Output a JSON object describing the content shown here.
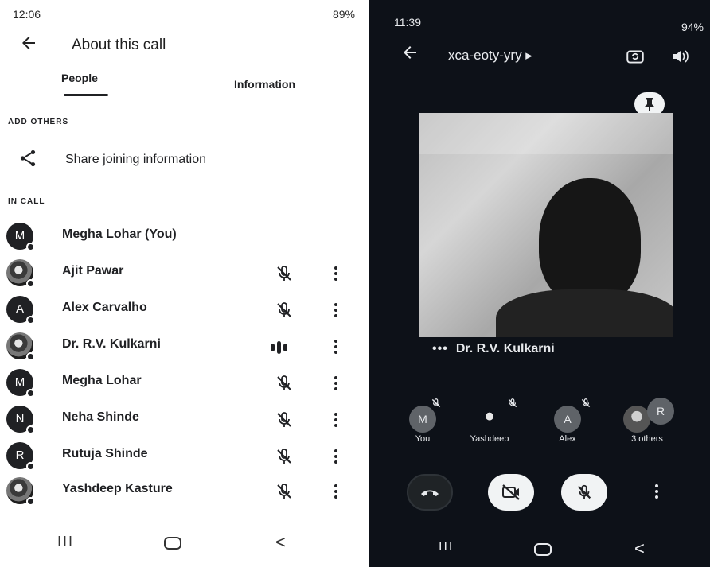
{
  "left_phone": {
    "status_bar": {
      "time": "12:06",
      "battery": "89%"
    },
    "app_bar": {
      "title": "About this call"
    },
    "tabs": [
      {
        "label": "People",
        "selected": true
      },
      {
        "label": "Information",
        "selected": false
      }
    ],
    "add_others": {
      "header": "ADD OTHERS",
      "share_label": "Share joining information"
    },
    "in_call": {
      "header": "IN CALL",
      "participants": [
        {
          "name": "Megha Lohar (You)",
          "initial": "M",
          "avatar": "letter",
          "mic": "none"
        },
        {
          "name": "Ajit Pawar",
          "initial": "",
          "avatar": "photo",
          "mic": "muted"
        },
        {
          "name": "Alex Carvalho",
          "initial": "A",
          "avatar": "letter",
          "mic": "muted"
        },
        {
          "name": "Dr. R.V. Kulkarni",
          "initial": "",
          "avatar": "photo",
          "mic": "speaking"
        },
        {
          "name": "Megha Lohar",
          "initial": "M",
          "avatar": "letter",
          "mic": "muted"
        },
        {
          "name": "Neha Shinde",
          "initial": "N",
          "avatar": "letter",
          "mic": "muted"
        },
        {
          "name": "Rutuja Shinde",
          "initial": "R",
          "avatar": "letter",
          "mic": "muted"
        },
        {
          "name": "Yashdeep Kasture",
          "initial": "",
          "avatar": "photo",
          "mic": "muted"
        }
      ]
    },
    "nav": {
      "recents": "III",
      "back": "<"
    }
  },
  "right_phone": {
    "status_bar": {
      "time": "11:39",
      "battery": "94%"
    },
    "top_bar": {
      "meeting_code": "xca-eoty-yry ▸"
    },
    "speaker": {
      "dots": "•••",
      "name": "Dr. R.V. Kulkarni"
    },
    "tiles": [
      {
        "label": "You",
        "initial": "M",
        "muted": true
      },
      {
        "label": "Yashdeep",
        "initial": "",
        "muted": true
      },
      {
        "label": "Alex",
        "initial": "A",
        "muted": true
      },
      {
        "label": "3 others",
        "initial": "R",
        "muted": false
      }
    ],
    "nav": {
      "recents": "III",
      "back": "<"
    }
  },
  "colors": {
    "accent_dark": "#202124",
    "meet_background": "#0d1118",
    "control_light": "#f1f3f4"
  }
}
